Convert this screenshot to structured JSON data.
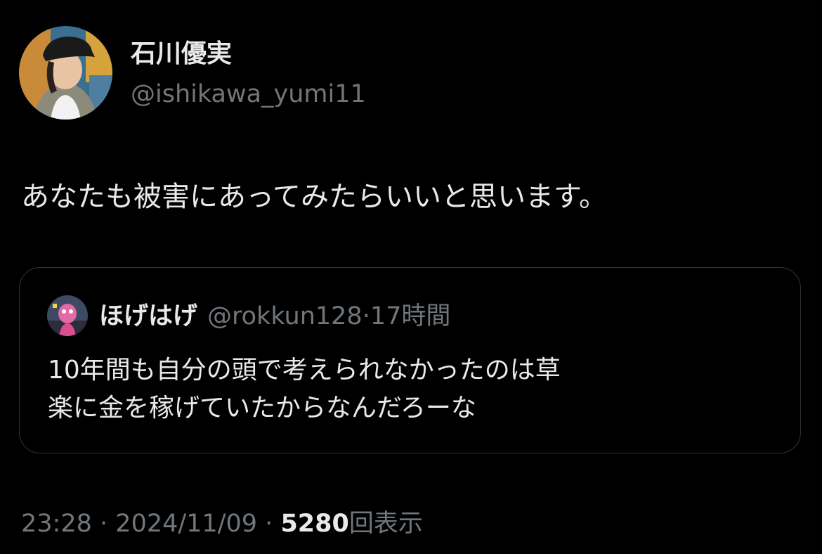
{
  "author": {
    "display_name": "石川優実",
    "handle": "@ishikawa_yumi11",
    "avatar_icon": "profile-photo"
  },
  "tweet": {
    "text": "あなたも被害にあってみたらいいと思います。"
  },
  "quoted_tweet": {
    "display_name": "ほげはげ",
    "handle": "@rokkun128",
    "separator": "·",
    "time_ago": "17時間",
    "lines": [
      "10年間も自分の頭で考えられなかったのは草",
      "楽に金を稼げていたからなんだろーな"
    ]
  },
  "meta": {
    "time": "23:28",
    "separator": "·",
    "date": "2024/11/09",
    "views_count": "5280",
    "views_label": "回表示"
  },
  "colors": {
    "background": "#000000",
    "primary_text": "#e7e9ea",
    "secondary_text": "#71767b",
    "border": "#2f3336"
  }
}
